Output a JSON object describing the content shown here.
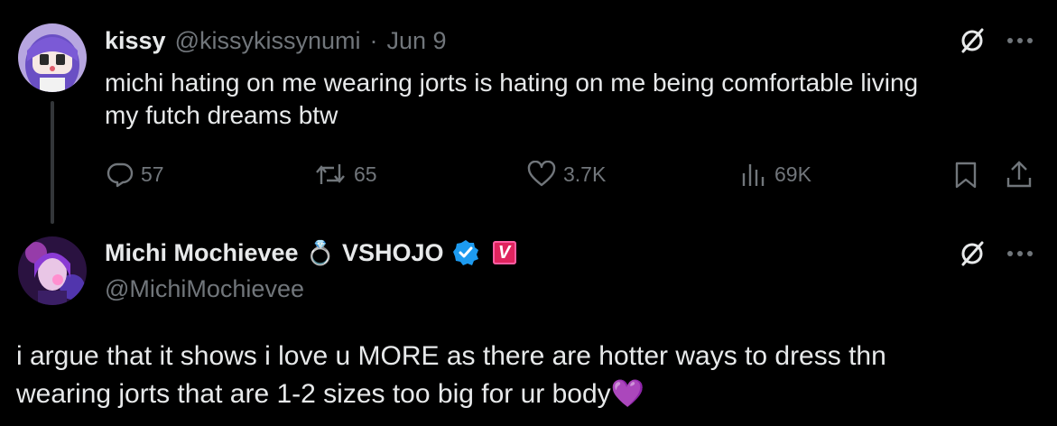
{
  "tweet1": {
    "display_name": "kissy",
    "handle": "@kissykissynumi",
    "separator": "·",
    "date": "Jun 9",
    "text_line1": "michi hating on me wearing jorts is hating on me being comfortable living",
    "text_line2": "my futch dreams btw",
    "replies": "57",
    "reposts": "65",
    "likes": "3.7K",
    "views": "69K"
  },
  "tweet2": {
    "display_name": "Michi Mochievee",
    "name_emoji": "💍",
    "name_suffix": "VSHOJO",
    "affiliate_badge_letter": "V",
    "handle": "@MichiMochievee",
    "text_line1": "i argue that it shows i love u MORE as there are hotter ways to dress thn",
    "text_line2": "wearing jorts that are 1-2 sizes too big for ur body",
    "text_emoji": "💜"
  },
  "colors": {
    "background": "#000000",
    "text_primary": "#e7e9ea",
    "text_secondary": "#71767b",
    "verified_blue": "#1d9bf0",
    "affiliate_pink": "#e0245e",
    "thread_line": "#333639"
  },
  "icons": [
    "grok-slash-icon",
    "more-dots-icon",
    "reply-icon",
    "repost-icon",
    "like-icon",
    "views-icon",
    "bookmark-icon",
    "share-icon",
    "verified-icon",
    "ring-icon",
    "purple-heart-icon"
  ]
}
